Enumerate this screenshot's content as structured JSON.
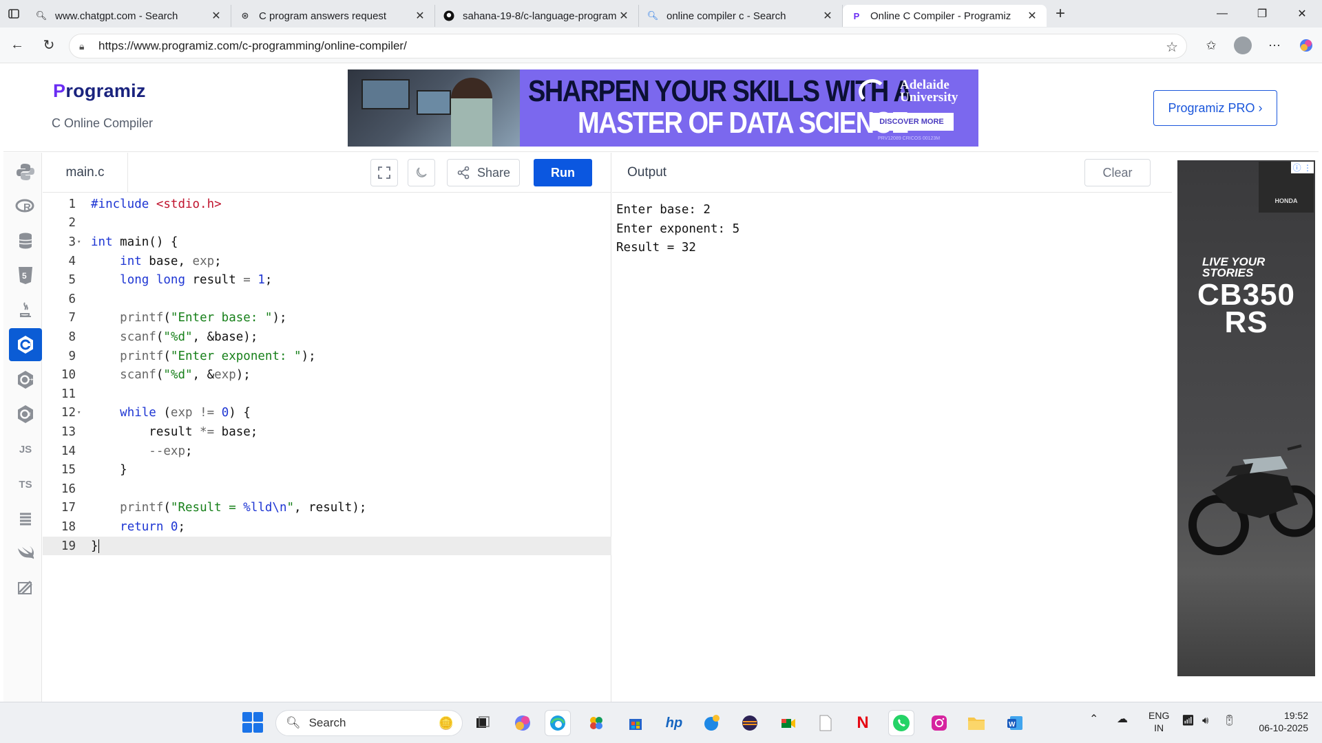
{
  "browser": {
    "tabs": [
      {
        "title": "www.chatgpt.com - Search",
        "icon": "search-icon"
      },
      {
        "title": "C program answers request",
        "icon": "chatgpt-icon"
      },
      {
        "title": "sahana-19-8/c-language-program",
        "icon": "github-icon"
      },
      {
        "title": "online compiler c - Search",
        "icon": "search-icon"
      },
      {
        "title": "Online C Compiler - Programiz",
        "icon": "programiz-icon",
        "active": true
      }
    ],
    "url": "https://www.programiz.com/c-programming/online-compiler/"
  },
  "site": {
    "logo": "rogramiz",
    "logo_p": "P",
    "subtitle": "C Online Compiler",
    "pro_button": "Programiz PRO ›",
    "banner": {
      "line1": "SHARPEN YOUR SKILLS WITH A",
      "line2": "MASTER OF DATA SCIENCE",
      "university": "Adelaide\nUniversity",
      "cta": "DISCOVER MORE",
      "fine": "PRV12089 CRICOS 00123M"
    }
  },
  "rail": {
    "items": [
      "python",
      "r",
      "sql",
      "html",
      "java",
      "c",
      "cpp",
      "csharp",
      "JS",
      "TS",
      "go",
      "swift",
      "rust"
    ],
    "active": "c"
  },
  "editor": {
    "file": "main.c",
    "share_label": "Share",
    "run_label": "Run",
    "current_line": 19
  },
  "output": {
    "title": "Output",
    "clear_label": "Clear",
    "text": "Enter base: 2\nEnter exponent: 5\nResult = 32"
  },
  "ad": {
    "brand": "HONDA",
    "tagline": "LIVE YOUR\nSTORIES",
    "model": "CB350\nRS"
  },
  "taskbar": {
    "search_placeholder": "Search",
    "lang": "ENG",
    "region": "IN",
    "time": "19:52",
    "date": "06-10-2025"
  },
  "colors": {
    "accent": "#0b57e0",
    "rail_active": "#0b5cd5",
    "banner": "#7b68ee"
  }
}
